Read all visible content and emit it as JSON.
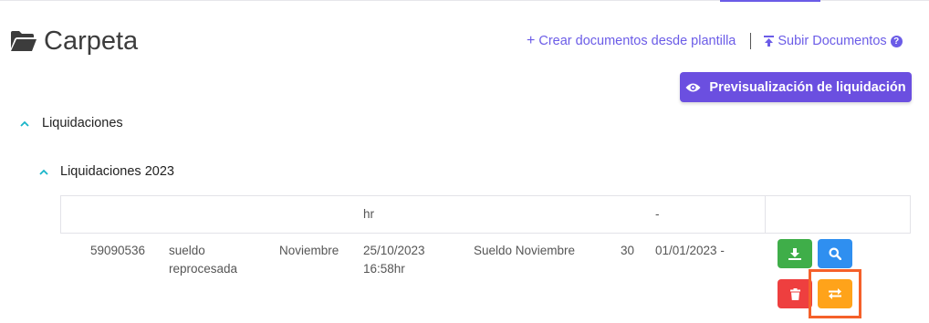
{
  "header": {
    "title": "Carpeta",
    "create_link": "Crear documentos desde plantilla",
    "create_plus": "+",
    "upload_link": "Subir Documentos",
    "help_glyph": "?"
  },
  "preview_button": {
    "label": "Previsualización de liquidación"
  },
  "tree": {
    "root_label": "Liquidaciones",
    "child_label": "Liquidaciones 2023"
  },
  "table": {
    "prev_row": {
      "date_tail": "hr",
      "period": "-"
    },
    "row": {
      "id": "59090536",
      "type_line1": "sueldo",
      "type_line2": "reprocesada",
      "month": "Noviembre",
      "date_line1": "25/10/2023",
      "date_line2": "16:58hr",
      "description": "Sueldo Noviembre",
      "days": "30",
      "period": "01/01/2023 -"
    },
    "actions": [
      "download-icon",
      "search-icon",
      "trash-icon",
      "swap-icon"
    ]
  },
  "colors": {
    "accent": "#6b5ce7",
    "primary_button": "#6b4fe0",
    "tree_caret": "#19b5c9",
    "download": "#3fae49",
    "view": "#2f8ff0",
    "delete": "#ee3f3f",
    "swap": "#ffa31a",
    "highlight": "#f5602a"
  }
}
